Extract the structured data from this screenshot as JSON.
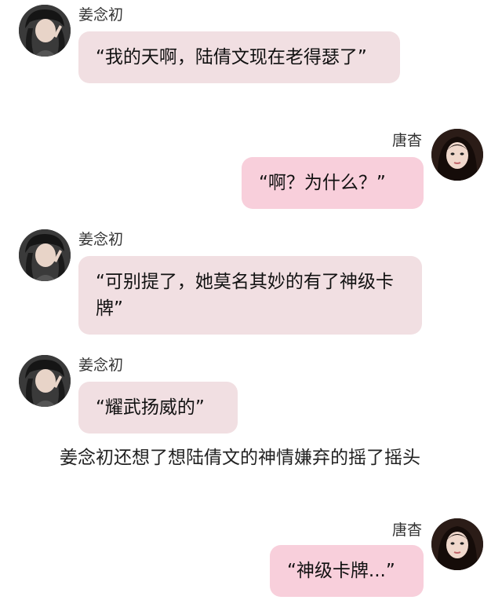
{
  "colors": {
    "left_bubble": "#f1dfe2",
    "right_bubble": "#f8cfdb"
  },
  "messages": [
    {
      "sender": "姜念初",
      "side": "left",
      "avatar_icon": "woman-avatar-icon",
      "text": "“我的天啊，陆倩文现在老得瑟了”"
    },
    {
      "sender": "唐杳",
      "side": "right",
      "avatar_icon": "woman-avatar-icon",
      "text": "“啊？为什么？”"
    },
    {
      "sender": "姜念初",
      "side": "left",
      "avatar_icon": "woman-avatar-icon",
      "text": "“可别提了，她莫名其妙的有了神级卡牌”"
    },
    {
      "sender": "姜念初",
      "side": "left",
      "avatar_icon": "woman-avatar-icon",
      "text": "“耀武扬威的”"
    },
    {
      "sender": "唐杳",
      "side": "right",
      "avatar_icon": "woman-avatar-icon",
      "text": "“神级卡牌...”"
    }
  ],
  "narration": "姜念初还想了想陆倩文的神情嫌弃的摇了摇头"
}
